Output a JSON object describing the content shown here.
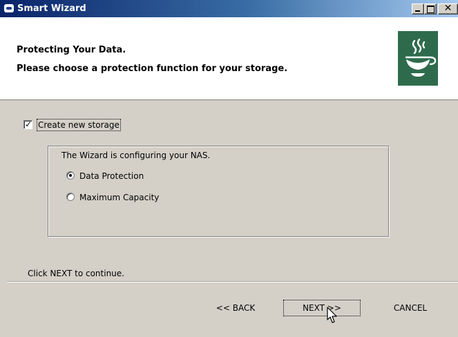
{
  "window": {
    "title": "Smart Wizard"
  },
  "header": {
    "title": "Protecting Your Data.",
    "subtitle": "Please choose a protection function for your storage."
  },
  "body": {
    "create_storage": {
      "label": "Create new storage",
      "checked": true
    },
    "group": {
      "title": "The Wizard is configuring your NAS.",
      "options": [
        {
          "label": "Data Protection",
          "selected": true
        },
        {
          "label": "Maximum Capacity",
          "selected": false
        }
      ]
    },
    "hint": "Click NEXT to continue."
  },
  "buttons": {
    "back": "<< BACK",
    "next": "NEXT >>",
    "cancel": "CANCEL"
  },
  "colors": {
    "titlebar_start": "#0a246a",
    "titlebar_end": "#a6caf0",
    "logo_bg": "#2e6b4c",
    "dialog_bg": "#d4d0c8"
  },
  "icons": {
    "logo": "steaming-bowl-icon",
    "app": "app-icon",
    "minimize": "minimize-icon",
    "maximize": "maximize-icon",
    "close": "close-icon",
    "cursor": "mouse-cursor-icon"
  }
}
